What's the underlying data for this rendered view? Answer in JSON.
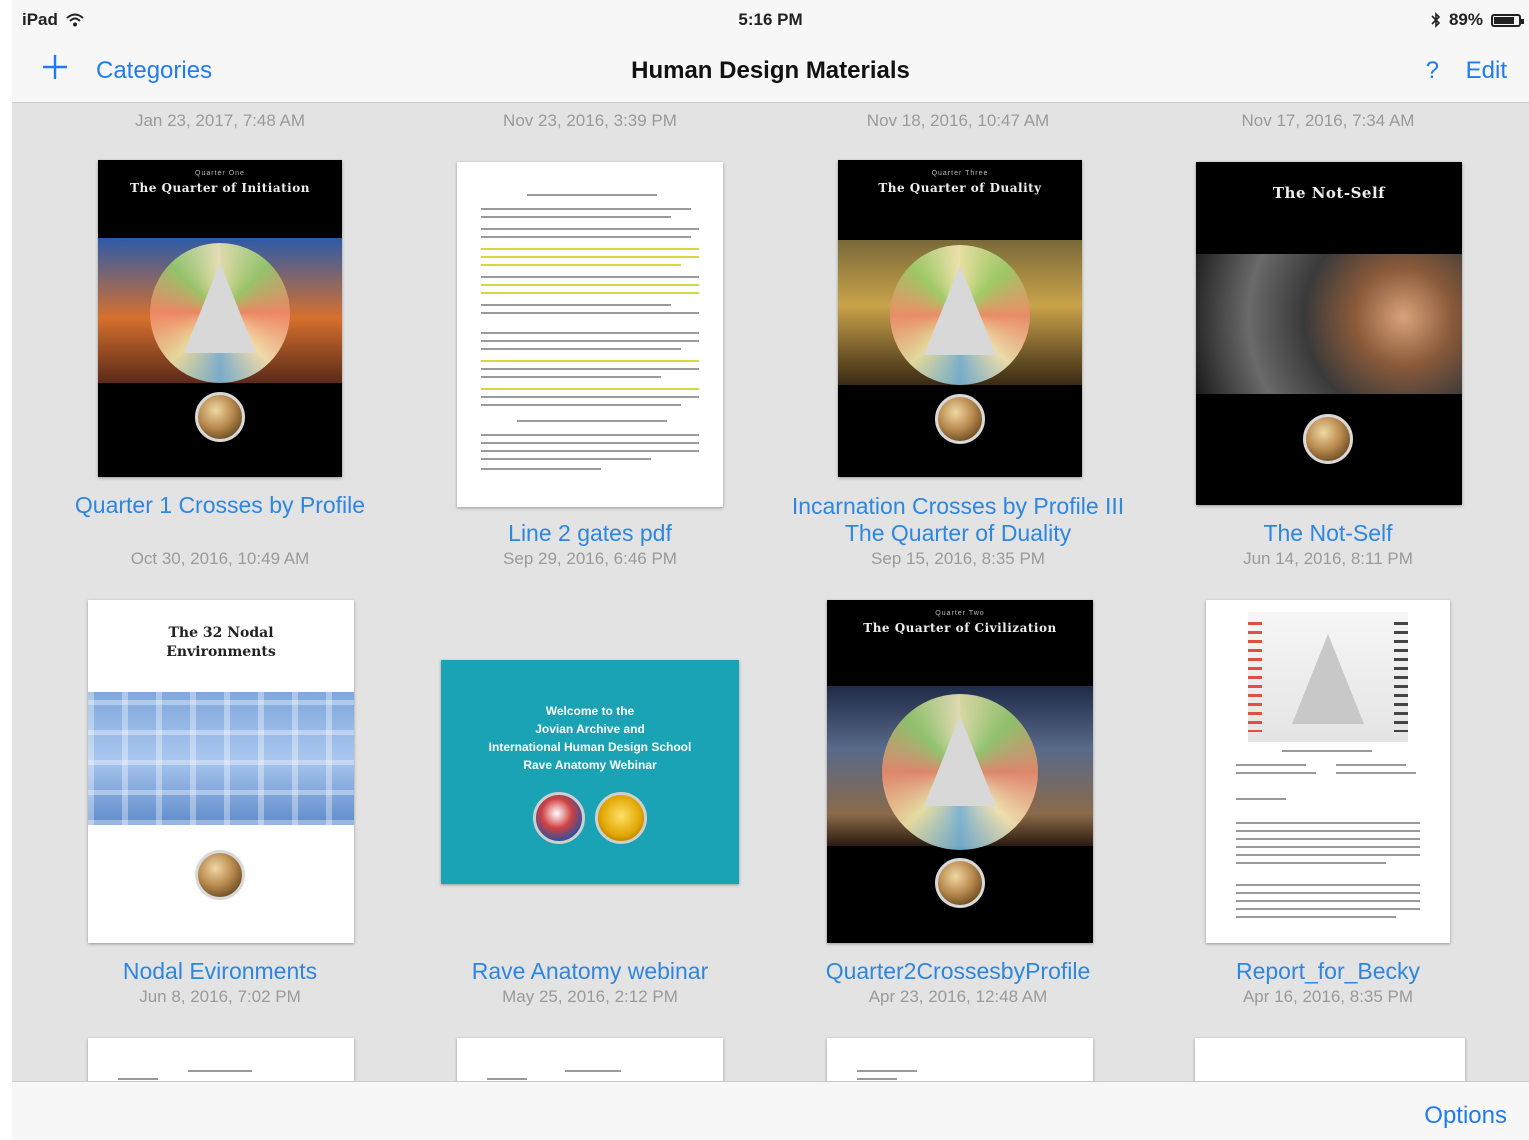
{
  "status_bar": {
    "device": "iPad",
    "time": "5:16 PM",
    "battery": "89%",
    "battery_level": 0.89
  },
  "nav": {
    "add_icon": "plus-icon",
    "categories": "Categories",
    "title": "Human Design Materials",
    "help": "?",
    "edit": "Edit"
  },
  "top_row_dates": [
    "Jan 23, 2017, 7:48 AM",
    "Nov 23, 2016, 3:39 PM",
    "Nov 18, 2016, 10:47 AM",
    "Nov 17, 2016, 7:34 AM"
  ],
  "documents": [
    {
      "title": "Quarter 1 Crosses by Profile",
      "date": "Oct 30, 2016, 10:49 AM"
    },
    {
      "title": "Line 2 gates pdf",
      "date": "Sep 29, 2016, 6:46 PM"
    },
    {
      "title": "Incarnation Crosses by Profile III The Quarter of Duality",
      "date": "Sep 15, 2016, 8:35 PM"
    },
    {
      "title": "The Not-Self",
      "date": "Jun 14, 2016, 8:11 PM"
    },
    {
      "title": "Nodal Evironments",
      "date": "Jun 8, 2016, 7:02 PM"
    },
    {
      "title": "Rave Anatomy webinar",
      "date": "May 25, 2016, 2:12 PM"
    },
    {
      "title": "Quarter2CrossesbyProfile",
      "date": "Apr 23, 2016, 12:48 AM"
    },
    {
      "title": "Report_for_Becky",
      "date": "Apr 16, 2016, 8:35 PM"
    }
  ],
  "covers": {
    "q1": {
      "line1": "Quarter One",
      "line2": "The Quarter of Initiation"
    },
    "q3": {
      "line1": "Quarter Three",
      "line2": "The Quarter of Duality"
    },
    "notself": {
      "line1": "The Not-Self"
    },
    "nodal": {
      "line1": "The 32 Nodal",
      "line2": "Environments"
    },
    "webinar": {
      "line1": "Welcome to the",
      "line2": "Jovian Archive and",
      "line3": "International Human Design School",
      "line4": "Rave Anatomy Webinar"
    },
    "q2": {
      "line1": "Quarter Two",
      "line2": "The Quarter of Civilization"
    }
  },
  "toolbar": {
    "options": "Options"
  },
  "colors": {
    "accent": "#1e7cf2",
    "link": "#2d86e0",
    "background": "#e3e3e3",
    "teal": "#1aa3b4"
  }
}
